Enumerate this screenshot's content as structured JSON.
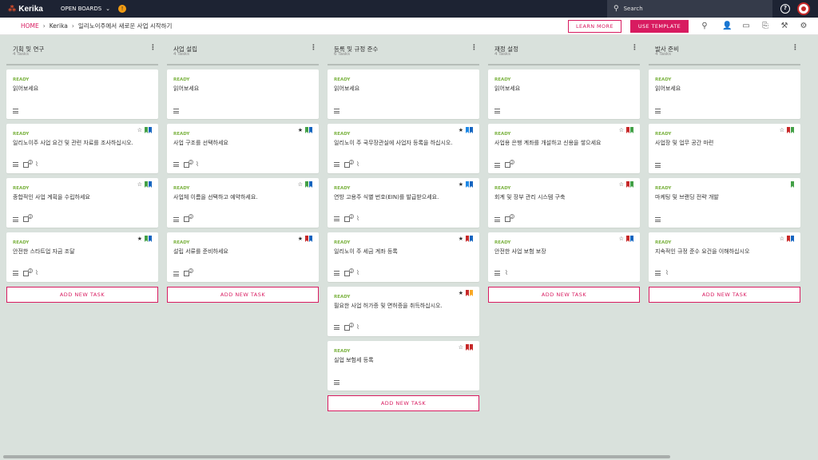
{
  "app": {
    "logo_text": "Kerika",
    "open_boards": "OPEN BOARDS",
    "search_placeholder": "Search"
  },
  "breadcrumb": {
    "home": "HOME",
    "org": "Kerika",
    "board": "일리노이주에서 새로운 사업 시작하기"
  },
  "toolbar": {
    "learn_more": "LEARN MORE",
    "use_template": "USE TEMPLATE"
  },
  "colors": {
    "accent": "#d81b60",
    "ready": "#7cb342",
    "topbar": "#1d2333"
  },
  "add_label": "ADD NEW TASK",
  "columns": [
    {
      "title": "기획 및 연구",
      "count": "4 Tasks",
      "cards": [
        {
          "status": "READY",
          "title": "읽어보세요",
          "star": "",
          "flags": [],
          "checklist": "",
          "attach": false
        },
        {
          "status": "READY",
          "title": "일리노이주 사업 요건 및 관련 자료를 조사하십시오.",
          "star": "☆",
          "flags": [
            "#43a047",
            "#1565c0"
          ],
          "checklist": "2",
          "attach": true
        },
        {
          "status": "READY",
          "title": "종합적인 사업 계획을 수립하세요",
          "star": "☆",
          "flags": [
            "#43a047",
            "#1565c0"
          ],
          "checklist": "2",
          "attach": false
        },
        {
          "status": "READY",
          "title": "안전한 스타트업 자금 조달",
          "star": "★",
          "flags": [
            "#43a047",
            "#1565c0"
          ],
          "checklist": "2",
          "attach": true
        }
      ]
    },
    {
      "title": "사업 설립",
      "count": "4 Tasks",
      "cards": [
        {
          "status": "READY",
          "title": "읽어보세요",
          "star": "",
          "flags": [],
          "checklist": "",
          "attach": false
        },
        {
          "status": "READY",
          "title": "사업 구조를 선택하세요",
          "star": "★",
          "flags": [
            "#43a047",
            "#1565c0"
          ],
          "checklist": "2",
          "attach": true
        },
        {
          "status": "READY",
          "title": "사업체 이름을 선택하고 예약하세요.",
          "star": "☆",
          "flags": [
            "#43a047",
            "#1565c0"
          ],
          "checklist": "2",
          "attach": false
        },
        {
          "status": "READY",
          "title": "설립 서류를 준비하세요",
          "star": "★",
          "flags": [
            "#c62828",
            "#1565c0"
          ],
          "checklist": "2",
          "attach": false
        }
      ]
    },
    {
      "title": "등록 및 규정 준수",
      "count": "6 Tasks",
      "cards": [
        {
          "status": "READY",
          "title": "읽어보세요",
          "star": "",
          "flags": [],
          "checklist": "",
          "attach": false
        },
        {
          "status": "READY",
          "title": "일리노이 주 국무장관실에 사업자 등록을 하십시오.",
          "star": "★",
          "flags": [
            "#1e88e5",
            "#1565c0"
          ],
          "checklist": "2",
          "attach": true
        },
        {
          "status": "READY",
          "title": "연방 고용주 식별 번호(EIN)를 발급받으세요.",
          "star": "★",
          "flags": [
            "#1e88e5",
            "#1565c0"
          ],
          "checklist": "2",
          "attach": true
        },
        {
          "status": "READY",
          "title": "일리노이 주 세금 계좌 등록",
          "star": "★",
          "flags": [
            "#c62828",
            "#1565c0"
          ],
          "checklist": "2",
          "attach": true
        },
        {
          "status": "READY",
          "title": "필요한 사업 허가증 및 면허증을 취득하십시오.",
          "star": "★",
          "flags": [
            "#c62828",
            "#f9a825"
          ],
          "checklist": "2",
          "attach": true
        },
        {
          "status": "READY",
          "title": "실업 보험세 등록",
          "star": "☆",
          "flags": [
            "#c62828",
            "#c62828"
          ],
          "checklist": "",
          "attach": false
        }
      ]
    },
    {
      "title": "재정 설정",
      "count": "4 Tasks",
      "cards": [
        {
          "status": "READY",
          "title": "읽어보세요",
          "star": "",
          "flags": [],
          "checklist": "",
          "attach": false
        },
        {
          "status": "READY",
          "title": "사업용 은행 계좌를 개설하고 신용을 쌓으세요",
          "star": "☆",
          "flags": [
            "#c62828",
            "#43a047"
          ],
          "checklist": "2",
          "attach": false
        },
        {
          "status": "READY",
          "title": "회계 및 장부 관리 시스템 구축",
          "star": "☆",
          "flags": [
            "#c62828",
            "#43a047"
          ],
          "checklist": "2",
          "attach": false
        },
        {
          "status": "READY",
          "title": "안전한 사업 보험 보장",
          "star": "☆",
          "flags": [
            "#c62828",
            "#1565c0"
          ],
          "checklist": "",
          "attach": true
        }
      ]
    },
    {
      "title": "발사 준비",
      "count": "4 Tasks",
      "cards": [
        {
          "status": "READY",
          "title": "읽어보세요",
          "star": "",
          "flags": [],
          "checklist": "",
          "attach": false
        },
        {
          "status": "READY",
          "title": "사업장 및 업무 공간 마련",
          "star": "☆",
          "flags": [
            "#c62828",
            "#43a047"
          ],
          "checklist": "",
          "attach": false
        },
        {
          "status": "READY",
          "title": "마케팅 및 브랜딩 전략 개발",
          "star": "",
          "flags": [
            "#43a047"
          ],
          "checklist": "",
          "attach": false
        },
        {
          "status": "READY",
          "title": "지속적인 규정 준수 요건을 이해하십시오",
          "star": "☆",
          "flags": [
            "#c62828",
            "#1565c0"
          ],
          "checklist": "",
          "attach": true
        }
      ]
    }
  ]
}
